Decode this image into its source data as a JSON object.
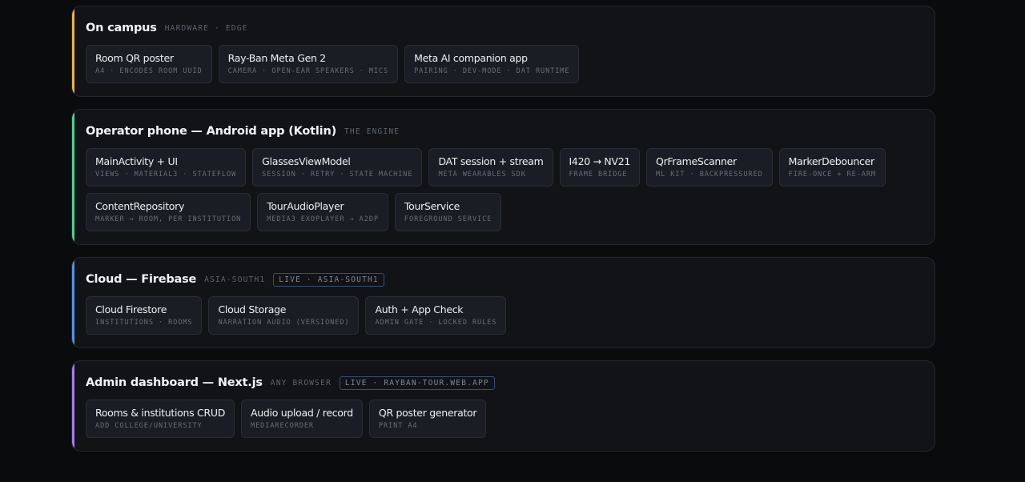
{
  "sections": [
    {
      "title": "On campus",
      "tag": "HARDWARE · EDGE",
      "pill": "",
      "accent": "#e8b450",
      "cards": [
        {
          "title": "Room QR poster",
          "sub": "A4 · ENCODES ROOM UUID"
        },
        {
          "title": "Ray-Ban Meta Gen 2",
          "sub": "CAMERA · OPEN-EAR SPEAKERS · MICS"
        },
        {
          "title": "Meta AI companion app",
          "sub": "PAIRING · DEV-MODE · DAT RUNTIME"
        }
      ]
    },
    {
      "title": "Operator phone — Android app (Kotlin)",
      "tag": "THE ENGINE",
      "pill": "",
      "accent": "#4fcf95",
      "cards": [
        {
          "title": "MainActivity + UI",
          "sub": "VIEWS · MATERIAL3 · STATEFLOW"
        },
        {
          "title": "GlassesViewModel",
          "sub": "SESSION · RETRY · STATE MACHINE"
        },
        {
          "title": "DAT session + stream",
          "sub": "META WEARABLES SDK"
        },
        {
          "title": "I420 → NV21",
          "sub": "FRAME BRIDGE"
        },
        {
          "title": "QrFrameScanner",
          "sub": "ML KIT · BACKPRESSURED"
        },
        {
          "title": "MarkerDebouncer",
          "sub": "FIRE-ONCE + RE-ARM"
        },
        {
          "title": "ContentRepository",
          "sub": "MARKER → ROOM, PER INSTITUTION"
        },
        {
          "title": "TourAudioPlayer",
          "sub": "MEDIA3 EXOPLAYER → A2DP"
        },
        {
          "title": "TourService",
          "sub": "FOREGROUND SERVICE"
        }
      ]
    },
    {
      "title": "Cloud — Firebase",
      "tag": "ASIA-SOUTH1",
      "pill": "LIVE · ASIA-SOUTH1",
      "accent": "#5b8fe0",
      "cards": [
        {
          "title": "Cloud Firestore",
          "sub": "INSTITUTIONS · ROOMS"
        },
        {
          "title": "Cloud Storage",
          "sub": "NARRATION AUDIO (VERSIONED)"
        },
        {
          "title": "Auth + App Check",
          "sub": "ADMIN GATE · LOCKED RULES"
        }
      ]
    },
    {
      "title": "Admin dashboard — Next.js",
      "tag": "ANY BROWSER",
      "pill": "LIVE · RAYBAN-TOUR.WEB.APP",
      "accent": "#a57ee8",
      "cards": [
        {
          "title": "Rooms & institutions CRUD",
          "sub": "ADD COLLEGE/UNIVERSITY"
        },
        {
          "title": "Audio upload / record",
          "sub": "MEDIARECORDER"
        },
        {
          "title": "QR poster generator",
          "sub": "PRINT A4"
        }
      ]
    }
  ]
}
